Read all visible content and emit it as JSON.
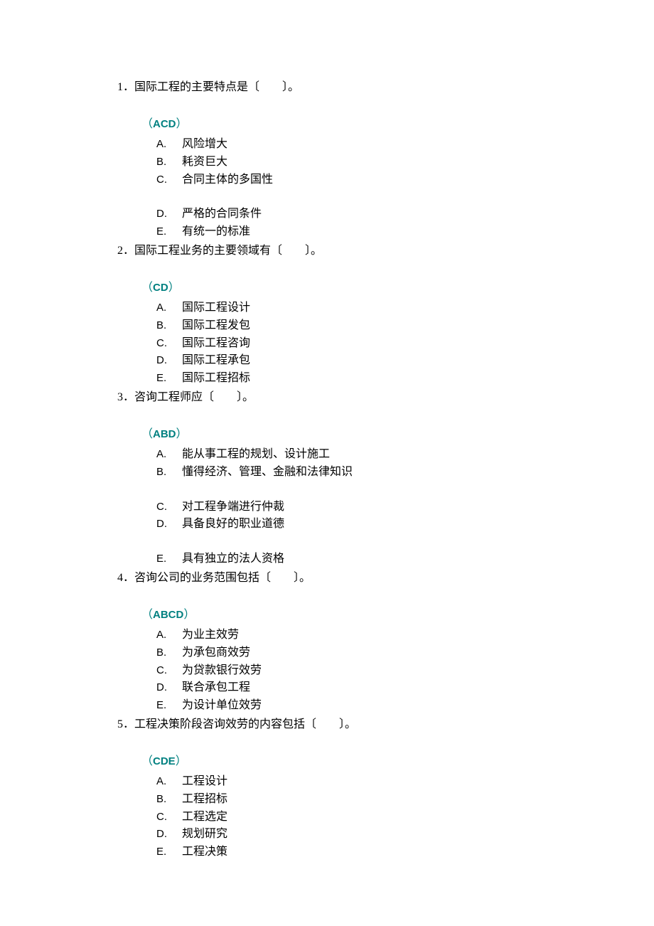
{
  "questions": [
    {
      "number": "1．",
      "stem": "国际工程的主要特点是〔　　〕。",
      "answer": "ACD",
      "options": [
        {
          "letter": "A.",
          "text": "风险增大",
          "gapAfter": false
        },
        {
          "letter": "B.",
          "text": "耗资巨大",
          "gapAfter": false
        },
        {
          "letter": "C.",
          "text": "合同主体的多国性",
          "gapAfter": true
        },
        {
          "letter": "D.",
          "text": "严格的合同条件",
          "gapAfter": false
        },
        {
          "letter": "E.",
          "text": "有统一的标准",
          "gapAfter": false
        }
      ]
    },
    {
      "number": "2．",
      "stem": "国际工程业务的主要领域有〔　　〕。",
      "answer": "CD",
      "options": [
        {
          "letter": "A.",
          "text": "国际工程设计",
          "gapAfter": false
        },
        {
          "letter": "B.",
          "text": "国际工程发包",
          "gapAfter": false
        },
        {
          "letter": "C.",
          "text": "国际工程咨询",
          "gapAfter": false
        },
        {
          "letter": "D.",
          "text": "国际工程承包",
          "gapAfter": false
        },
        {
          "letter": "E.",
          "text": "国际工程招标",
          "gapAfter": false
        }
      ]
    },
    {
      "number": "3．",
      "stem": "咨询工程师应〔　　〕。",
      "answer": "ABD",
      "options": [
        {
          "letter": "A.",
          "text": "能从事工程的规划、设计施工",
          "gapAfter": false
        },
        {
          "letter": "B.",
          "text": "懂得经济、管理、金融和法律知识",
          "gapAfter": true
        },
        {
          "letter": "C.",
          "text": "对工程争端进行仲裁",
          "gapAfter": false
        },
        {
          "letter": "D.",
          "text": "具备良好的职业道德",
          "gapAfter": true
        },
        {
          "letter": "E.",
          "text": "具有独立的法人资格",
          "gapAfter": false
        }
      ]
    },
    {
      "number": "4．",
      "stem": "咨询公司的业务范围包括〔　　〕。",
      "answer": "ABCD",
      "options": [
        {
          "letter": "A.",
          "text": "为业主效劳",
          "gapAfter": false
        },
        {
          "letter": "B.",
          "text": "为承包商效劳",
          "gapAfter": false
        },
        {
          "letter": "C.",
          "text": "为贷款银行效劳",
          "gapAfter": false
        },
        {
          "letter": "D.",
          "text": "联合承包工程",
          "gapAfter": false
        },
        {
          "letter": "E.",
          "text": "为设计单位效劳",
          "gapAfter": false
        }
      ]
    },
    {
      "number": "5．",
      "stem": "工程决策阶段咨询效劳的内容包括〔　　〕。",
      "answer": "CDE",
      "options": [
        {
          "letter": "A.",
          "text": "工程设计",
          "gapAfter": false
        },
        {
          "letter": "B.",
          "text": "工程招标",
          "gapAfter": false
        },
        {
          "letter": "C.",
          "text": "工程选定",
          "gapAfter": false
        },
        {
          "letter": "D.",
          "text": "规划研究",
          "gapAfter": false
        },
        {
          "letter": "E.",
          "text": "工程决策",
          "gapAfter": false
        }
      ]
    }
  ],
  "parenOpen": "（",
  "parenClose": "）"
}
